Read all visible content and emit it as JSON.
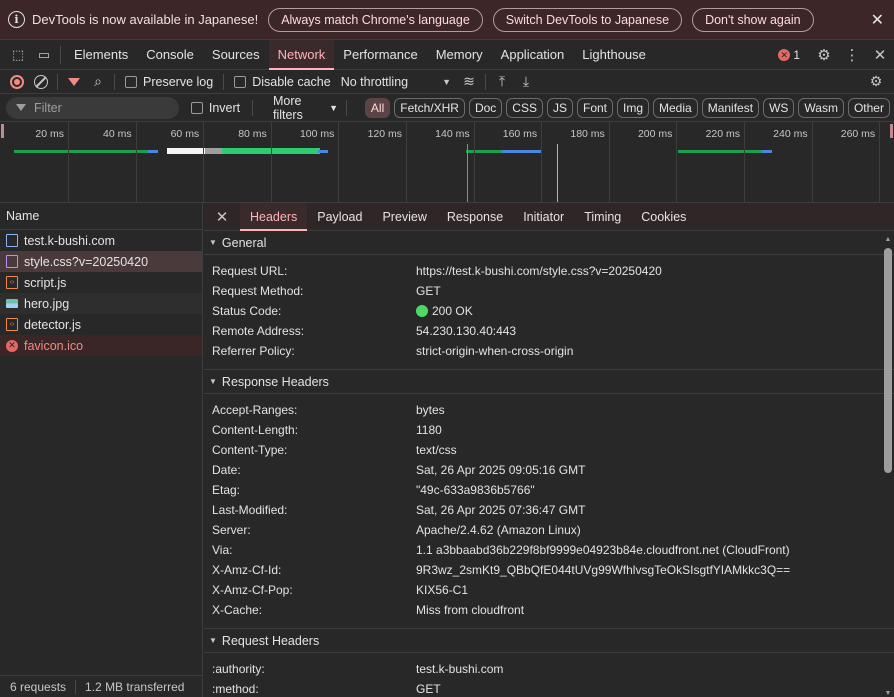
{
  "infobar": {
    "message": "DevTools is now available in Japanese!",
    "btn_match": "Always match Chrome's language",
    "btn_switch": "Switch DevTools to Japanese",
    "btn_dont_show": "Don't show again",
    "close": "✕"
  },
  "maintabs": {
    "items": [
      "Elements",
      "Console",
      "Sources",
      "Network",
      "Performance",
      "Memory",
      "Application",
      "Lighthouse"
    ],
    "active": "Network",
    "error_count": "1"
  },
  "toolbar": {
    "preserve_log": "Preserve log",
    "disable_cache": "Disable cache",
    "throttling": "No throttling"
  },
  "filter": {
    "placeholder": "Filter",
    "invert": "Invert",
    "more_filters": "More filters",
    "types": [
      "All",
      "Fetch/XHR",
      "Doc",
      "CSS",
      "JS",
      "Font",
      "Img",
      "Media",
      "Manifest",
      "WS",
      "Wasm",
      "Other"
    ],
    "active_type": "All"
  },
  "overview": {
    "ticks": [
      "20 ms",
      "40 ms",
      "60 ms",
      "80 ms",
      "100 ms",
      "120 ms",
      "140 ms",
      "160 ms",
      "180 ms",
      "200 ms",
      "220 ms",
      "240 ms",
      "260 ms"
    ]
  },
  "requests": {
    "header": "Name",
    "items": [
      {
        "name": "test.k-bushi.com",
        "type": "doc"
      },
      {
        "name": "style.css?v=20250420",
        "type": "css",
        "selected": true
      },
      {
        "name": "script.js",
        "type": "js"
      },
      {
        "name": "hero.jpg",
        "type": "img"
      },
      {
        "name": "detector.js",
        "type": "js"
      },
      {
        "name": "favicon.ico",
        "type": "error"
      }
    ],
    "footer_count": "6 requests",
    "footer_transferred": "1.2 MB transferred"
  },
  "detail": {
    "tabs": [
      "Headers",
      "Payload",
      "Preview",
      "Response",
      "Initiator",
      "Timing",
      "Cookies"
    ],
    "active_tab": "Headers",
    "general": {
      "title": "General",
      "rows": [
        {
          "k": "Request URL:",
          "v": "https://test.k-bushi.com/style.css?v=20250420"
        },
        {
          "k": "Request Method:",
          "v": "GET"
        },
        {
          "k": "Status Code:",
          "v": "200 OK",
          "status": true
        },
        {
          "k": "Remote Address:",
          "v": "54.230.130.40:443"
        },
        {
          "k": "Referrer Policy:",
          "v": "strict-origin-when-cross-origin"
        }
      ]
    },
    "response_headers": {
      "title": "Response Headers",
      "rows": [
        {
          "k": "Accept-Ranges:",
          "v": "bytes"
        },
        {
          "k": "Content-Length:",
          "v": "1180"
        },
        {
          "k": "Content-Type:",
          "v": "text/css"
        },
        {
          "k": "Date:",
          "v": "Sat, 26 Apr 2025 09:05:16 GMT"
        },
        {
          "k": "Etag:",
          "v": "\"49c-633a9836b5766\""
        },
        {
          "k": "Last-Modified:",
          "v": "Sat, 26 Apr 2025 07:36:47 GMT"
        },
        {
          "k": "Server:",
          "v": "Apache/2.4.62 (Amazon Linux)"
        },
        {
          "k": "Via:",
          "v": "1.1 a3bbaabd36b229f8bf9999e04923b84e.cloudfront.net (CloudFront)"
        },
        {
          "k": "X-Amz-Cf-Id:",
          "v": "9R3wz_2smKt9_QBbQfE044tUVg99WfhlvsgTeOkSIsgtfYIAMkkc3Q=="
        },
        {
          "k": "X-Amz-Cf-Pop:",
          "v": "KIX56-C1"
        },
        {
          "k": "X-Cache:",
          "v": "Miss from cloudfront"
        }
      ]
    },
    "request_headers": {
      "title": "Request Headers",
      "rows": [
        {
          "k": ":authority:",
          "v": "test.k-bushi.com"
        },
        {
          "k": ":method:",
          "v": "GET"
        }
      ]
    }
  },
  "colors": {
    "accent": "#ffb3bb",
    "infobar_bg": "#3c2628",
    "status_ok": "#4cd964",
    "error": "#e46962"
  }
}
